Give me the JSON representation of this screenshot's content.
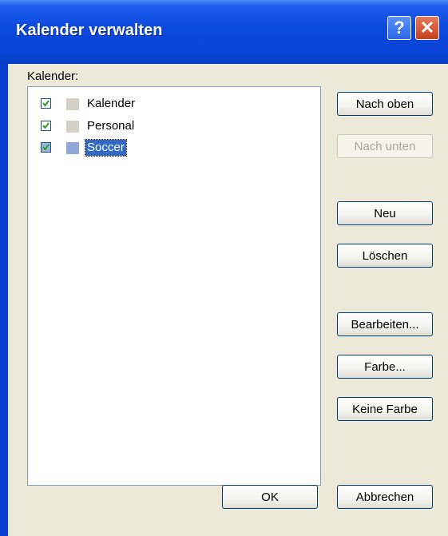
{
  "window": {
    "title": "Kalender verwalten",
    "help_label": "?",
    "close_label": "✕"
  },
  "calendars_label": "Kalender:",
  "calendars": [
    {
      "label": "Kalender",
      "checked": true,
      "swatch_color": "#d4d0c8",
      "selected": false
    },
    {
      "label": "Personal",
      "checked": true,
      "swatch_color": "#d4d0c8",
      "selected": false
    },
    {
      "label": "Soccer",
      "checked": true,
      "swatch_color": "#8fa8d8",
      "selected": true
    }
  ],
  "buttons": {
    "move_up": "Nach oben",
    "move_down": "Nach unten",
    "new": "Neu",
    "delete": "Löschen",
    "edit": "Bearbeiten...",
    "color": "Farbe...",
    "no_color": "Keine Farbe",
    "ok": "OK",
    "cancel": "Abbrechen"
  }
}
